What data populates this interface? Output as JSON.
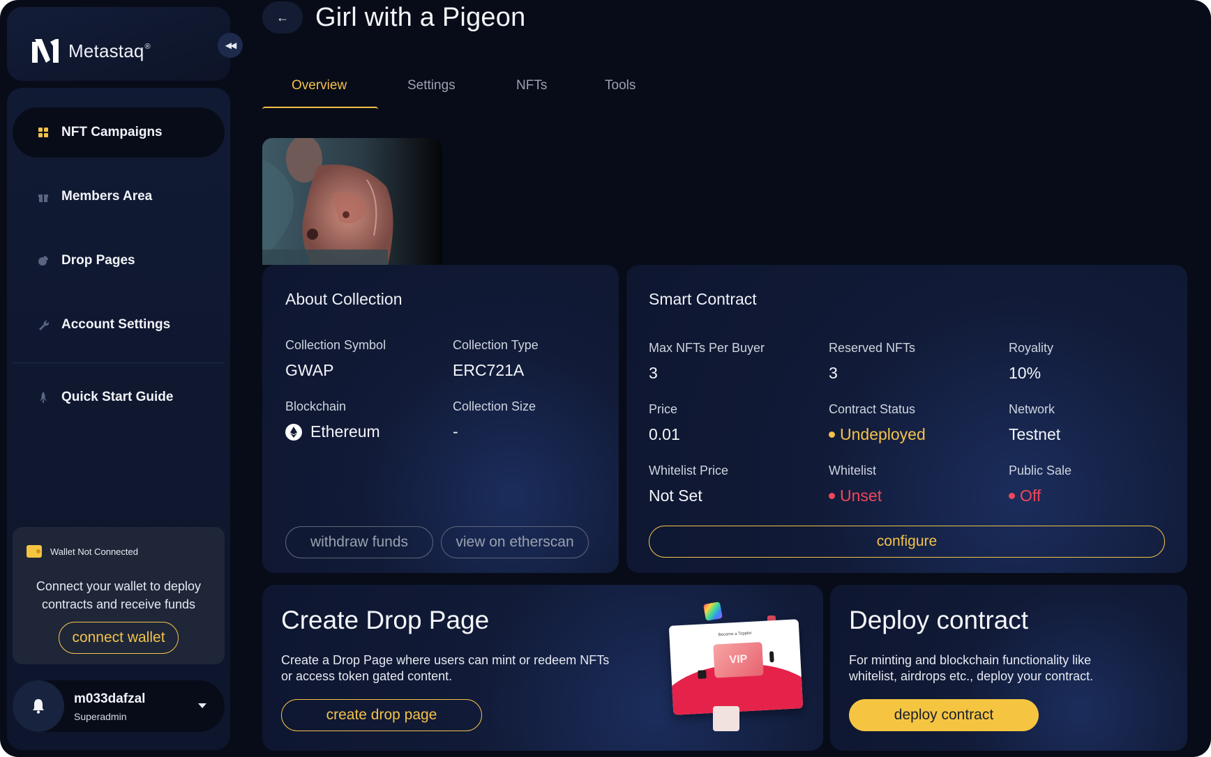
{
  "brand": {
    "name": "Metastaq",
    "trademark": "®"
  },
  "sidebar": {
    "items": [
      {
        "label": "NFT Campaigns",
        "icon": "grid-icon"
      },
      {
        "label": "Members Area",
        "icon": "gift-icon"
      },
      {
        "label": "Drop Pages",
        "icon": "pie-icon"
      },
      {
        "label": "Account Settings",
        "icon": "wrench-icon"
      },
      {
        "label": "Quick Start Guide",
        "icon": "rocket-icon"
      }
    ]
  },
  "wallet": {
    "status": "Wallet Not Connected",
    "message": "Connect your wallet to deploy contracts and receive funds",
    "button": "connect wallet"
  },
  "user": {
    "name": "m033dafzal",
    "role": "Superadmin"
  },
  "header": {
    "title": "Girl with a Pigeon"
  },
  "tabs": [
    {
      "label": "Overview",
      "active": true
    },
    {
      "label": "Settings",
      "active": false
    },
    {
      "label": "NFTs",
      "active": false
    },
    {
      "label": "Tools",
      "active": false
    }
  ],
  "about": {
    "title": "About Collection",
    "symbol_label": "Collection Symbol",
    "symbol_value": "GWAP",
    "type_label": "Collection Type",
    "type_value": "ERC721A",
    "blockchain_label": "Blockchain",
    "blockchain_value": "Ethereum",
    "size_label": "Collection Size",
    "size_value": "-",
    "withdraw_button": "withdraw funds",
    "etherscan_button": "view on etherscan"
  },
  "contract": {
    "title": "Smart Contract",
    "max_label": "Max NFTs Per Buyer",
    "max_value": "3",
    "reserved_label": "Reserved NFTs",
    "reserved_value": "3",
    "royalty_label": "Royality",
    "royalty_value": "10%",
    "price_label": "Price",
    "price_value": "0.01",
    "status_label": "Contract Status",
    "status_value": "Undeployed",
    "network_label": "Network",
    "network_value": "Testnet",
    "wl_price_label": "Whitelist Price",
    "wl_price_value": "Not Set",
    "whitelist_label": "Whitelist",
    "whitelist_value": "Unset",
    "public_label": "Public Sale",
    "public_value": "Off",
    "configure_button": "configure"
  },
  "drop": {
    "title": "Create Drop Page",
    "description": "Create a Drop Page where users can mint or redeem NFTs or access token gated content.",
    "button": "create drop page",
    "preview_heading": "Become a Toppler",
    "preview_badge": "VIP"
  },
  "deploy": {
    "title": "Deploy contract",
    "description": "For minting and blockchain functionality like whitelist, airdrops etc., deploy your contract.",
    "button": "deploy contract"
  },
  "colors": {
    "accent": "#f3c24a",
    "danger": "#f0475a",
    "background": "#080c18",
    "card": "#111a36"
  }
}
